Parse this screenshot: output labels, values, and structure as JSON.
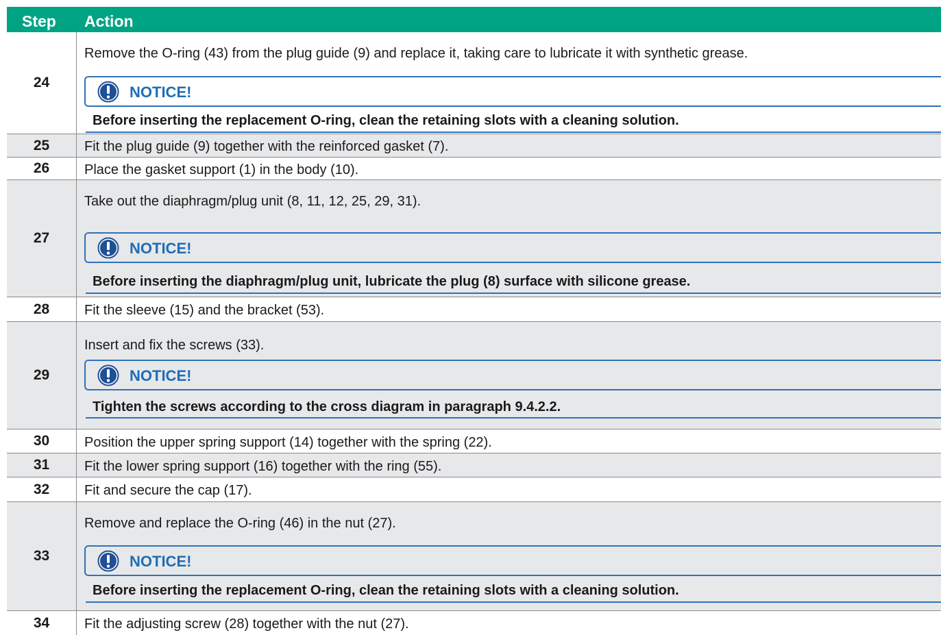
{
  "header": {
    "step": "Step",
    "action": "Action"
  },
  "rows": [
    {
      "step": "24",
      "action": "Remove the O-ring (43) from the plug guide (9) and replace it, taking care to lubricate it with synthetic grease.",
      "notice_title": "NOTICE!",
      "notice_text": "Before inserting the replacement O-ring, clean the retaining slots with a cleaning solution."
    },
    {
      "step": "25",
      "action": "Fit the plug guide (9) together with the reinforced gasket (7)."
    },
    {
      "step": "26",
      "action": "Place the gasket support (1) in the body (10)."
    },
    {
      "step": "27",
      "action": "Take out the diaphragm/plug unit (8, 11, 12, 25, 29, 31).",
      "notice_title": "NOTICE!",
      "notice_text": "Before inserting the diaphragm/plug unit, lubricate the plug (8) surface with silicone grease."
    },
    {
      "step": "28",
      "action": "Fit the sleeve (15) and the bracket (53)."
    },
    {
      "step": "29",
      "action": "Insert and fix the screws (33).",
      "notice_title": "NOTICE!",
      "notice_text": "Tighten the screws according to the cross diagram in paragraph 9.4.2.2."
    },
    {
      "step": "30",
      "action": "Position the upper spring support (14) together with the spring (22)."
    },
    {
      "step": "31",
      "action": "Fit the lower spring support (16) together with the ring (55)."
    },
    {
      "step": "32",
      "action": "Fit and secure the cap (17)."
    },
    {
      "step": "33",
      "action": "Remove and replace the O-ring (46) in the nut (27).",
      "notice_title": "NOTICE!",
      "notice_text": "Before inserting the replacement O-ring, clean the retaining slots with a cleaning solution."
    },
    {
      "step": "34",
      "action": "Fit the adjusting screw (28) together with the nut (27)."
    }
  ],
  "colors": {
    "header_bg": "#00a383",
    "notice_blue": "#1f6db5",
    "row_gray": "#e7e8ea"
  },
  "icons": {
    "notice": "exclamation-circle-icon"
  }
}
